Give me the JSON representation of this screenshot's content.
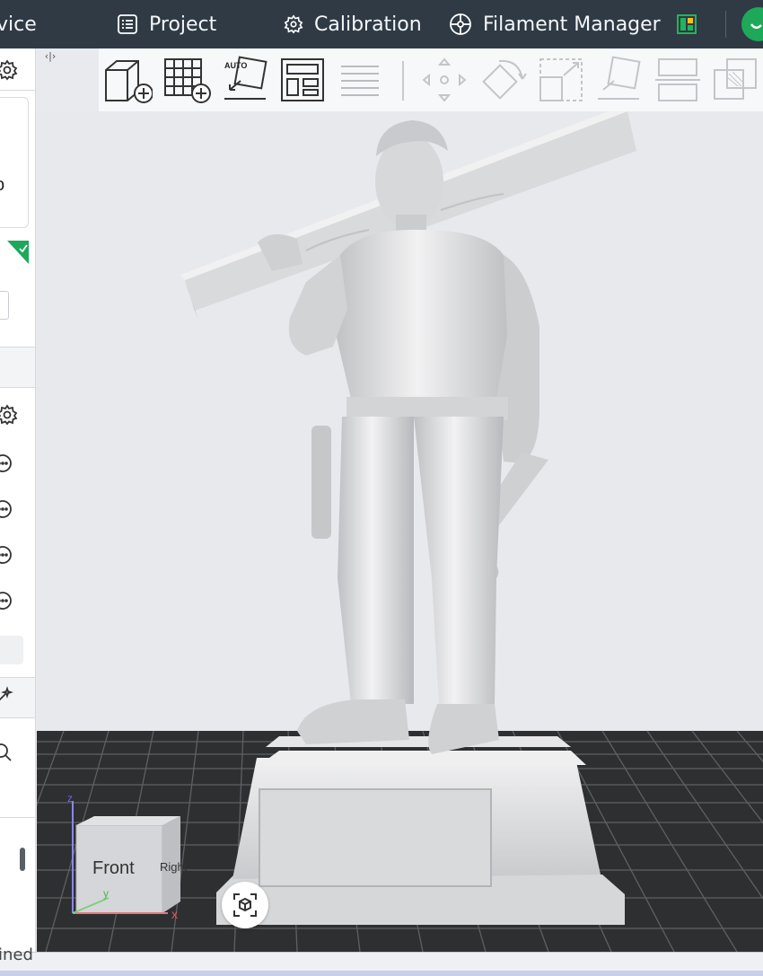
{
  "topbar": {
    "tabs": [
      {
        "label": "vice",
        "icon": "device-icon"
      },
      {
        "label": "Project",
        "icon": "list-icon"
      },
      {
        "label": "Calibration",
        "icon": "gear-badge-icon"
      },
      {
        "label": "Filament Manager",
        "icon": "spool-icon"
      }
    ],
    "colors": {
      "background": "#2f3a45",
      "avatar": "#1ea85a",
      "square_icon": "#23b35b"
    }
  },
  "sidebar": {
    "card_text": "o",
    "icons": [
      "gear-icon",
      "gear-icon",
      "more-icon",
      "more-icon",
      "more-icon",
      "more-icon",
      "wand-icon",
      "search-icon"
    ]
  },
  "toolbar": {
    "buttons": [
      "add-object",
      "add-plate",
      "auto-orient",
      "arrange",
      "split-objects",
      "move",
      "rotate",
      "scale",
      "lay-on-face",
      "cut",
      "boolean"
    ],
    "auto_label": "AUTO"
  },
  "view_cube": {
    "front_label": "Front",
    "right_label": "Right",
    "axis_x": "x",
    "axis_y": "y",
    "axis_z": "z"
  },
  "status": {
    "text": "ined"
  }
}
